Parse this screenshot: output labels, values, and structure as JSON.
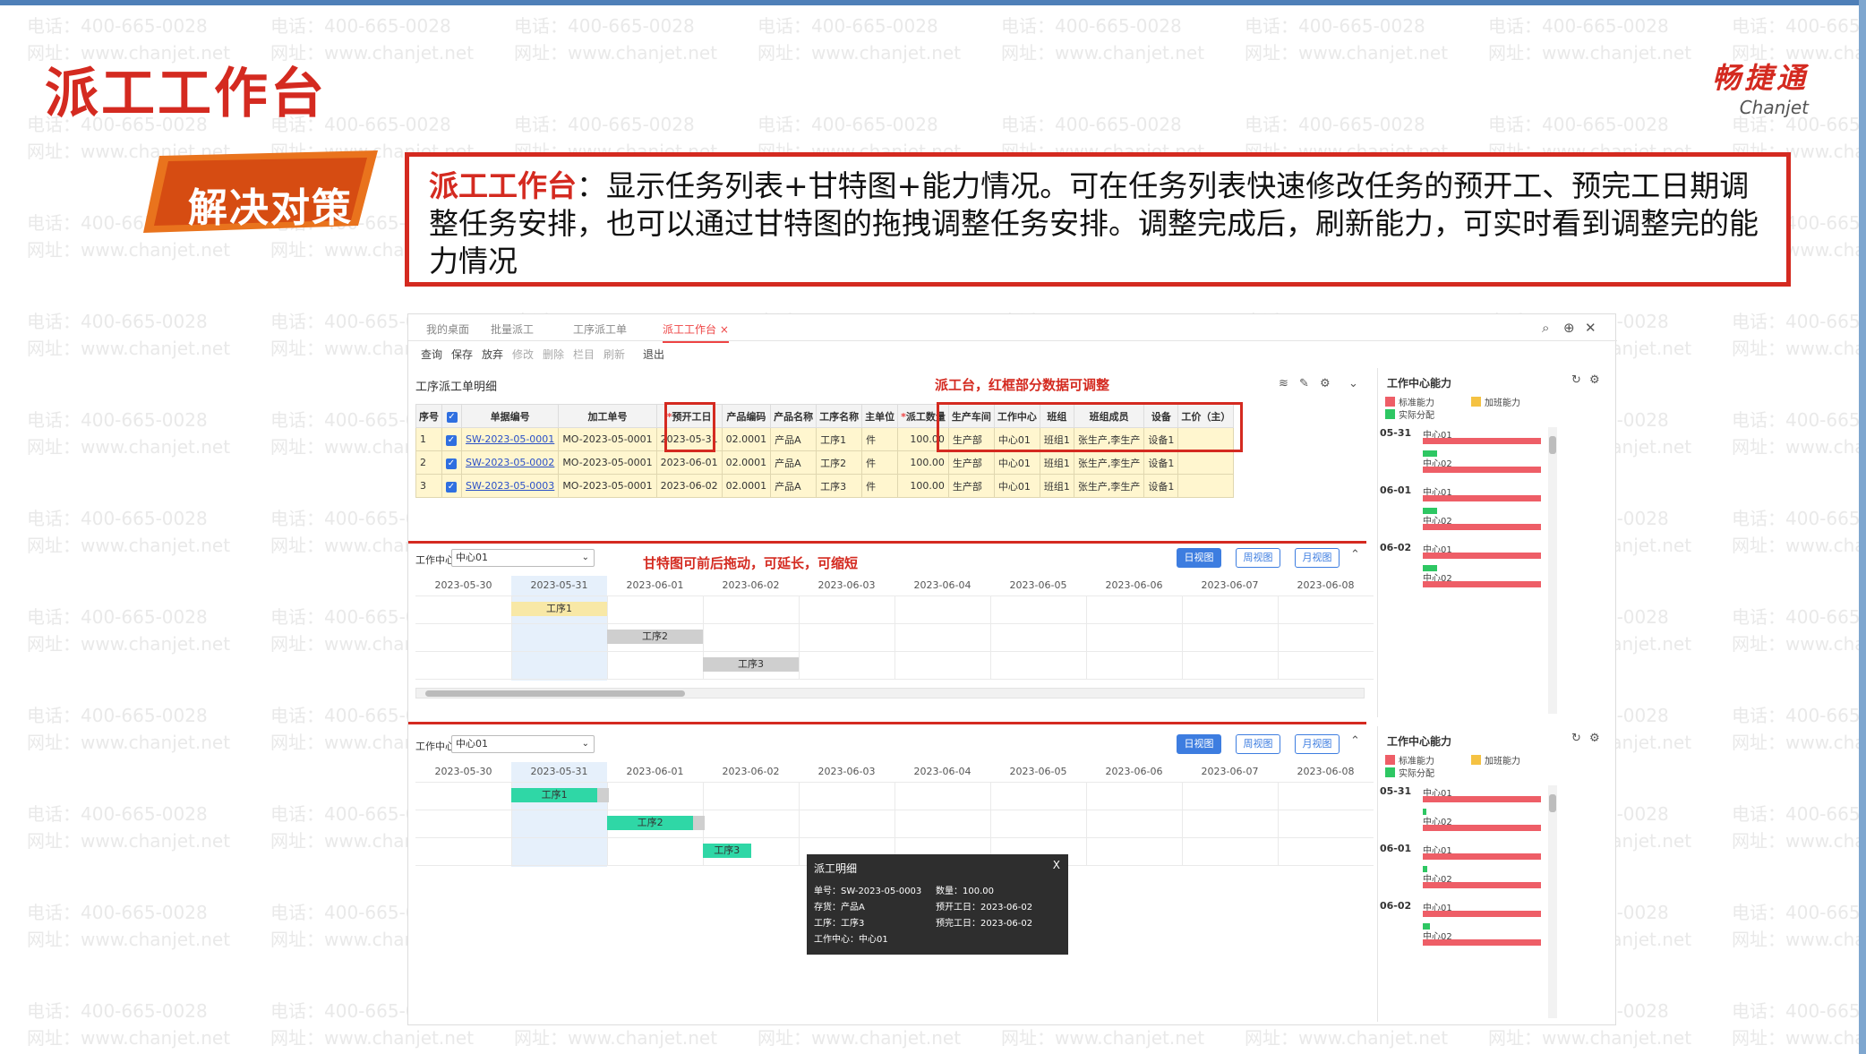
{
  "watermark": {
    "phone": "电话：400-665-0028",
    "site": "网址：www.chanjet.net"
  },
  "title": "派工工作台",
  "logo": {
    "cn": "畅捷通",
    "en": "Chanjet"
  },
  "banner": "解决对策",
  "callout": {
    "highlight": "派工工作台",
    "text": "：显示任务列表+甘特图+能力情况。可在任务列表快速修改任务的预开工、预完工日期调整任务安排，也可以通过甘特图的拖拽调整任务安排。调整完成后，刷新能力，可实时看到调整完的能力情况"
  },
  "app": {
    "tabs": [
      "我的桌面",
      "批量派工",
      "工序派工单",
      "派工工作台"
    ],
    "active_tab": "派工工作台",
    "toolbar": [
      {
        "label": "查询",
        "enabled": true
      },
      {
        "label": "保存",
        "enabled": true
      },
      {
        "label": "放弃",
        "enabled": true
      },
      {
        "label": "修改",
        "enabled": false
      },
      {
        "label": "删除",
        "enabled": false
      },
      {
        "label": "栏目",
        "enabled": false
      },
      {
        "label": "刷新",
        "enabled": false
      },
      {
        "label": "退出",
        "enabled": true
      }
    ],
    "section_title": "工序派工单明细",
    "note_table": "派工台，红框部分数据可调整",
    "note_gantt": "甘特图可前后拖动，可延长，可缩短",
    "columns": [
      "序号",
      "",
      "单据编号",
      "加工单号",
      "预开工日",
      "产品编码",
      "产品名称",
      "工序名称",
      "主单位",
      "派工数量",
      "生产车间",
      "工作中心",
      "班组",
      "班组成员",
      "设备",
      "工价（主）"
    ],
    "rows": [
      [
        "1",
        "✓",
        "SW-2023-05-0001",
        "MO-2023-05-0001",
        "2023-05-31",
        "02.0001",
        "产品A",
        "工序1",
        "件",
        "100.00",
        "生产部",
        "中心01",
        "班组1",
        "张生产,李生产",
        "设备1",
        ""
      ],
      [
        "2",
        "✓",
        "SW-2023-05-0002",
        "MO-2023-05-0001",
        "2023-06-01",
        "02.0001",
        "产品A",
        "工序2",
        "件",
        "100.00",
        "生产部",
        "中心01",
        "班组1",
        "张生产,李生产",
        "设备1",
        ""
      ],
      [
        "3",
        "✓",
        "SW-2023-05-0003",
        "MO-2023-05-0001",
        "2023-06-02",
        "02.0001",
        "产品A",
        "工序3",
        "件",
        "100.00",
        "生产部",
        "中心01",
        "班组1",
        "张生产,李生产",
        "设备1",
        ""
      ]
    ],
    "wc_label": "工作中心:",
    "wc_value": "中心01",
    "views": [
      "日视图",
      "周视图",
      "月视图"
    ],
    "dates": [
      "2023-05-30",
      "2023-05-31",
      "2023-06-01",
      "2023-06-02",
      "2023-06-03",
      "2023-06-04",
      "2023-06-05",
      "2023-06-06",
      "2023-06-07",
      "2023-06-08"
    ],
    "tasks": [
      "工序1",
      "工序2",
      "工序3"
    ],
    "capacity": {
      "title": "工作中心能力",
      "legend": {
        "std": "标准能力",
        "ot": "加班能力",
        "actual": "实际分配"
      },
      "colors": {
        "std": "#ee5e67",
        "ot": "#f5c242",
        "actual": "#2ec763"
      },
      "days": [
        {
          "date": "05-31",
          "centers": [
            "中心01",
            "中心02"
          ]
        },
        {
          "date": "06-01",
          "centers": [
            "中心01",
            "中心02"
          ]
        },
        {
          "date": "06-02",
          "centers": [
            "中心01",
            "中心02"
          ]
        }
      ]
    },
    "tooltip": {
      "title": "派工明细",
      "close": "X",
      "l1a": "单号：SW-2023-05-0003",
      "l1b": "数量：100.00",
      "l2a": "存货：产品A",
      "l2b": "预开工日：2023-06-02",
      "l3a": "工序：工序3",
      "l3b": "预完工日：2023-06-02",
      "l4": "工作中心：中心01"
    }
  }
}
